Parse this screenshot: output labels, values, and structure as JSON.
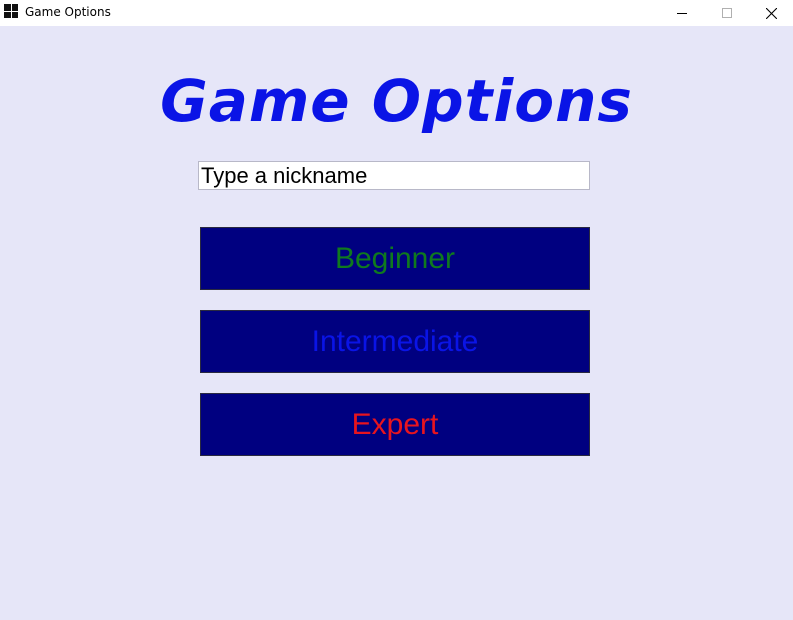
{
  "window": {
    "title": "Game Options",
    "icon": "grid-app-icon"
  },
  "title_controls": {
    "minimize_icon": "minimize-icon",
    "maximize_icon": "maximize-icon",
    "close_icon": "close-icon"
  },
  "main": {
    "heading": "Game Options",
    "nickname": {
      "value": "",
      "placeholder": "Type a nickname"
    },
    "levels": [
      {
        "label": "Beginner",
        "color": "#0f7a1e"
      },
      {
        "label": "Intermediate",
        "color": "#0a14e6"
      },
      {
        "label": "Expert",
        "color": "#e8141e"
      }
    ]
  },
  "colors": {
    "background": "#e6e6f8",
    "heading": "#0a14e6",
    "button_bg": "#000080"
  }
}
